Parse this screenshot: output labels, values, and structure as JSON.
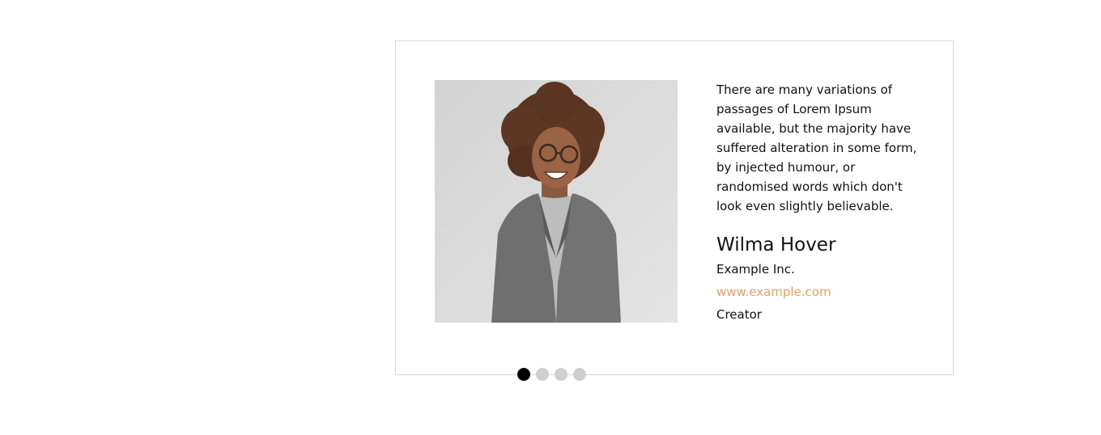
{
  "testimonial": {
    "quote": "There are many variations of passages of Lorem Ipsum available, but the majority have suffered alteration in some form, by injected humour, or randomised words which don't look even slightly believable.",
    "name": "Wilma Hover",
    "company": "Example Inc.",
    "website": "www.example.com",
    "role": "Creator",
    "photo_icon": "person-photo"
  },
  "pagination": {
    "total": 4,
    "active_index": 0,
    "dots": [
      {
        "label": "slide-1",
        "active": true
      },
      {
        "label": "slide-2",
        "active": false
      },
      {
        "label": "slide-3",
        "active": false
      },
      {
        "label": "slide-4",
        "active": false
      }
    ]
  },
  "colors": {
    "link": "#e8a160",
    "active_dot": "#000000",
    "inactive_dot": "#cfcfcf",
    "border": "#d8d8d8"
  }
}
